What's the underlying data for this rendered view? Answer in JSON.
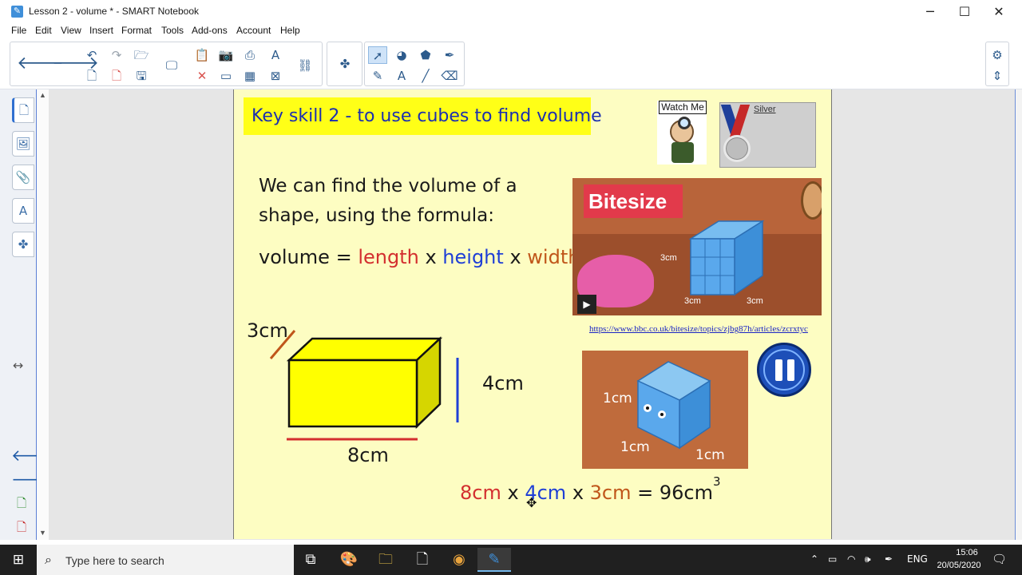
{
  "window": {
    "title": "Lesson 2 - volume * - SMART Notebook",
    "minimize": "─",
    "maximize": "☐",
    "close": "✕"
  },
  "menu": [
    "File",
    "Edit",
    "View",
    "Insert",
    "Format",
    "Tools",
    "Add-ons",
    "Account",
    "Help"
  ],
  "slide": {
    "key_skill": "Key skill 2 - to use cubes to find volume",
    "intro_line1": "We can find the volume of a",
    "intro_line2": "shape, using the formula:",
    "formula": {
      "volume": "volume",
      "eq": "=",
      "length": "length",
      "x1": "x",
      "height": "height",
      "x2": "x",
      "width": "width"
    },
    "cuboid": {
      "depth_label": "3cm",
      "height_label": "4cm",
      "length_label": "8cm",
      "colors": {
        "face": "#ffff00",
        "side": "#d6d600",
        "depth_line": "#c0561a",
        "height_line": "#1f3fd6",
        "length_line": "#d32f2f"
      }
    },
    "answer": {
      "a": "8cm",
      "x1": "x",
      "b": "4cm",
      "x2": "x",
      "c": "3cm",
      "eq": "=",
      "result": "96cm",
      "power": "3"
    },
    "watch_me_label": "Watch Me",
    "medal_label": "Silver",
    "video": {
      "brand": "Bitesize",
      "dim_a": "3cm",
      "dim_b": "3cm",
      "dim_c": "3cm"
    },
    "link": "https://www.bbc.co.uk/bitesize/topics/zjbg87h/articles/zcrxtyc",
    "cube_image": {
      "dim_1": "1cm",
      "dim_2": "1cm",
      "dim_3": "1cm"
    },
    "background": "#fdfdc2"
  },
  "taskbar": {
    "search_placeholder": "Type here to search",
    "language": "ENG",
    "time": "15:06",
    "date": "20/05/2020"
  }
}
